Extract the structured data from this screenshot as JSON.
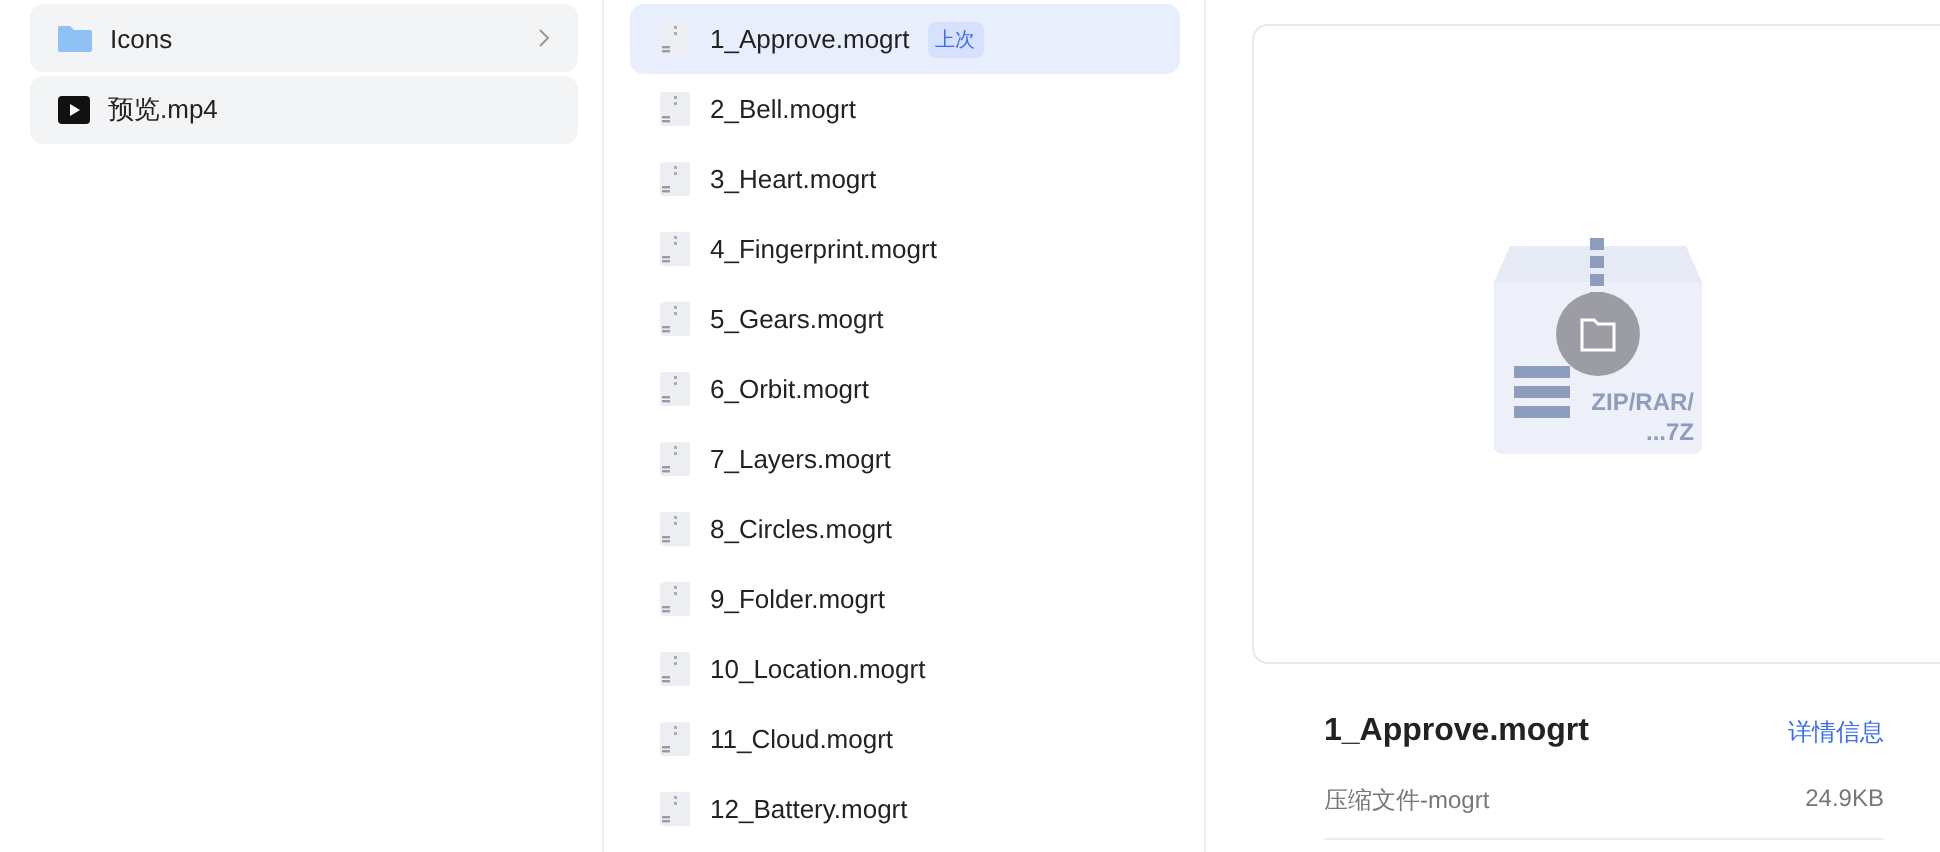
{
  "folders": [
    {
      "kind": "folder",
      "name": "Icons"
    },
    {
      "kind": "video",
      "name": "预览.mp4"
    }
  ],
  "files": [
    {
      "name": "1_Approve.mogrt",
      "selected": true,
      "badge": "上次"
    },
    {
      "name": "2_Bell.mogrt",
      "selected": false
    },
    {
      "name": "3_Heart.mogrt",
      "selected": false
    },
    {
      "name": "4_Fingerprint.mogrt",
      "selected": false
    },
    {
      "name": "5_Gears.mogrt",
      "selected": false
    },
    {
      "name": "6_Orbit.mogrt",
      "selected": false
    },
    {
      "name": "7_Layers.mogrt",
      "selected": false
    },
    {
      "name": "8_Circles.mogrt",
      "selected": false
    },
    {
      "name": "9_Folder.mogrt",
      "selected": false
    },
    {
      "name": "10_Location.mogrt",
      "selected": false
    },
    {
      "name": "11_Cloud.mogrt",
      "selected": false
    },
    {
      "name": "12_Battery.mogrt",
      "selected": false
    }
  ],
  "preview": {
    "archive_label": [
      "ZIP/RAR/",
      "...7Z"
    ],
    "title": "1_Approve.mogrt",
    "details_link": "详情信息",
    "type": "压缩文件-mogrt",
    "size": "24.9KB"
  }
}
